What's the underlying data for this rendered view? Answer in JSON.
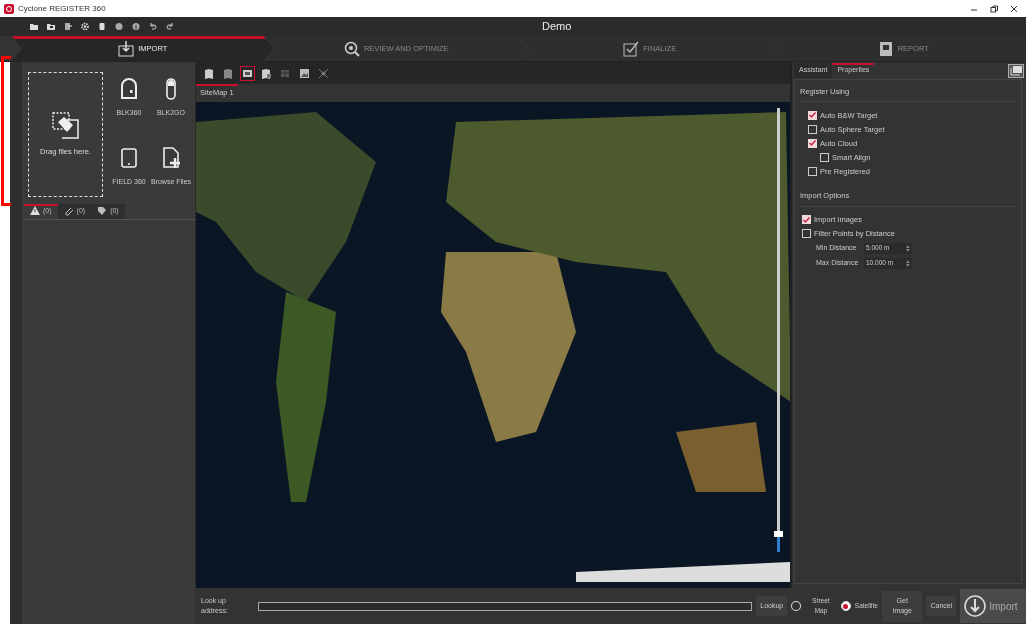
{
  "app_title": "Cyclone REGISTER 360",
  "document_title": "Demo",
  "steps": [
    {
      "label": "IMPORT",
      "kind": "import",
      "selected": true
    },
    {
      "label": "REVIEW AND OPTIMIZE",
      "kind": "review",
      "selected": false
    },
    {
      "label": "FINALIZE",
      "kind": "finalize",
      "selected": false
    },
    {
      "label": "REPORT",
      "kind": "report",
      "selected": false
    }
  ],
  "drop_zone": {
    "label": "Drag files here."
  },
  "sources": [
    {
      "label": "BLK360",
      "kind": "blk360"
    },
    {
      "label": "BLK2GO",
      "kind": "blk2go"
    },
    {
      "label": "FIELD 360",
      "kind": "tablet"
    },
    {
      "label": "Browse Files",
      "kind": "file-add"
    }
  ],
  "log_tabs": [
    {
      "count": "(0)",
      "kind": "warning",
      "selected": true
    },
    {
      "count": "(0)",
      "kind": "paperclip",
      "selected": false
    },
    {
      "count": "(0)",
      "kind": "tags",
      "selected": false
    }
  ],
  "map_tools": [
    {
      "kind": "map-add",
      "selected": false
    },
    {
      "kind": "map-remove",
      "selected": false
    },
    {
      "kind": "fit",
      "selected": true
    },
    {
      "kind": "map-layers",
      "selected": false
    },
    {
      "kind": "grid",
      "selected": false
    },
    {
      "kind": "picture",
      "selected": false
    },
    {
      "kind": "link",
      "selected": false
    }
  ],
  "map_tabs": [
    {
      "label": "SiteMap 1",
      "selected": true
    }
  ],
  "zoom_slider": {
    "level": 0.04
  },
  "panel_tabs": [
    {
      "label": "Assistant",
      "selected": false
    },
    {
      "label": "Properties",
      "selected": true
    }
  ],
  "register_using": {
    "title": "Register Using",
    "options": [
      {
        "label": "Auto B&W Target",
        "checked": true
      },
      {
        "label": "Auto Sphere Target",
        "checked": false
      },
      {
        "label": "Auto Cloud",
        "checked": true,
        "children": [
          {
            "label": "Smart Align",
            "checked": false
          }
        ]
      },
      {
        "label": "Pre Registered",
        "checked": false
      }
    ]
  },
  "import_options": {
    "title": "Import Options",
    "options": [
      {
        "label": "Import Images",
        "checked": true
      },
      {
        "label": "Filter Points by Distance",
        "checked": false
      }
    ],
    "fields": [
      {
        "label": "Min Distance",
        "value": "5.000 m"
      },
      {
        "label": "Max Distance",
        "value": "10.000 m"
      }
    ]
  },
  "address_bar": {
    "label": "Look up address:",
    "lookup": "Lookup",
    "map_types": [
      {
        "label": "Street Map",
        "selected": false
      },
      {
        "label": "Satellite",
        "selected": true
      }
    ],
    "get_image": "Get Image",
    "cancel": "Cancel"
  },
  "import_button": {
    "label": "Import"
  }
}
